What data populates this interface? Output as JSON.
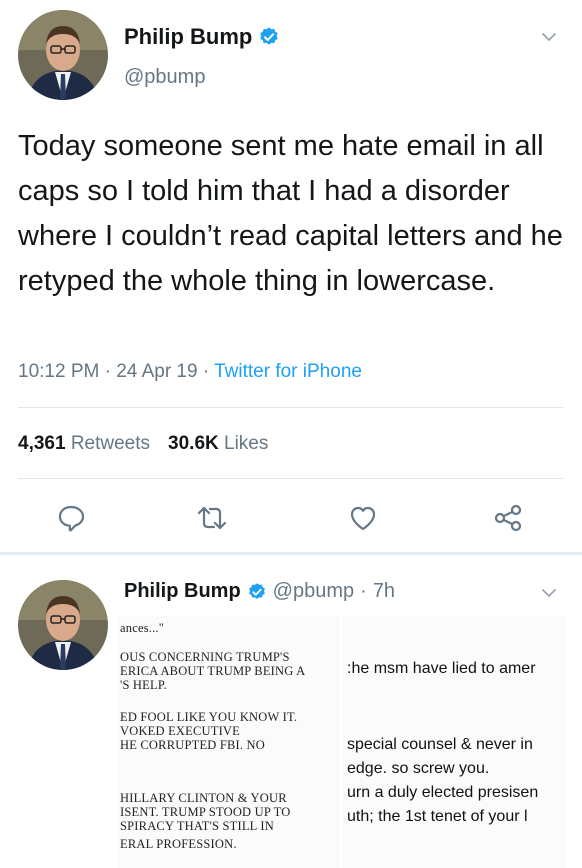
{
  "tweet": {
    "author_name": "Philip Bump",
    "handle": "@pbump",
    "verified": true,
    "text": "Today someone sent me hate email in all caps so I told him that I had a disorder where I couldn’t read capital letters and he retyped the whole thing in lowercase.",
    "time": "10:12 PM",
    "date": "24 Apr 19",
    "source": "Twitter for iPhone",
    "retweets_count": "4,361",
    "retweets_label": "Retweets",
    "likes_count": "30.6K",
    "likes_label": "Likes",
    "icons": [
      "verified-icon",
      "chevron-down-icon",
      "reply-icon",
      "retweet-icon",
      "like-icon",
      "share-icon"
    ],
    "accent_color": "#1da1f2"
  },
  "reply": {
    "author_name": "Philip Bump",
    "handle": "@pbump",
    "age": "7h",
    "attached_image_left": {
      "lines": [
        "ances...\"",
        "OUS CONCERNING TRUMP'S",
        "ERICA ABOUT TRUMP BEING A",
        "'S HELP.",
        "ED FOOL LIKE YOU KNOW IT.",
        "VOKED EXECUTIVE",
        "HE CORRUPTED FBI. NO",
        "HILLARY CLINTON & YOUR",
        "ISENT. TRUMP STOOD UP TO",
        "SPIRACY THAT'S STILL IN",
        "ERAL PROFESSION."
      ]
    },
    "attached_image_right": {
      "lines": [
        ":he msm have lied to amer",
        "special counsel & never in",
        "edge. so screw you.",
        "urn a duly elected presisen",
        "uth; the 1st tenet of your l"
      ]
    }
  }
}
